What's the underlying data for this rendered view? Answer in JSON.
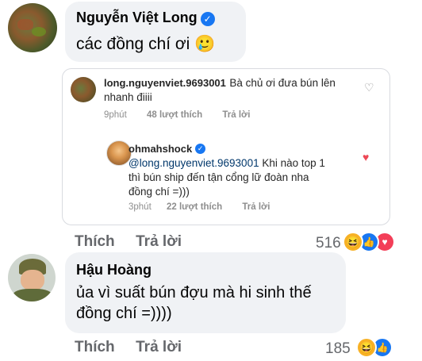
{
  "comment1": {
    "author": "Nguyễn Việt Long",
    "text": "các đồng chí ơi",
    "emoji": "🥲",
    "actions": {
      "like": "Thích",
      "reply": "Trả lời"
    },
    "reaction_count": "516"
  },
  "screenshot": {
    "c1": {
      "username": "long.nguyenviet.9693001",
      "text": "Bà chủ ơi đưa bún lên nhanh điiii",
      "time": "9phút",
      "likes": "48 lượt thích",
      "reply": "Trả lời"
    },
    "c2": {
      "username": "ohmahshock",
      "mention": "@long.nguyenviet.9693001",
      "text_line1": " Khi nào top 1",
      "text_line2": "thì bún ship đến tận cổng lữ đoàn nha",
      "text_line3": "đồng chí =)))",
      "time": "3phút",
      "likes": "22 lượt thích",
      "reply": "Trả lời"
    }
  },
  "comment2": {
    "author": "Hậu Hoàng",
    "text_line1": "ủa vì suất bún đợu mà hi sinh thế",
    "text_line2": "đồng chí =))))",
    "actions": {
      "like": "Thích",
      "reply": "Trả lời"
    },
    "reaction_count": "185"
  },
  "colors": {
    "fb_blue": "#1877f2",
    "haha": "#f7b125",
    "love": "#f33e58",
    "ig_heart": "#ed4956",
    "mention": "#00376b"
  }
}
